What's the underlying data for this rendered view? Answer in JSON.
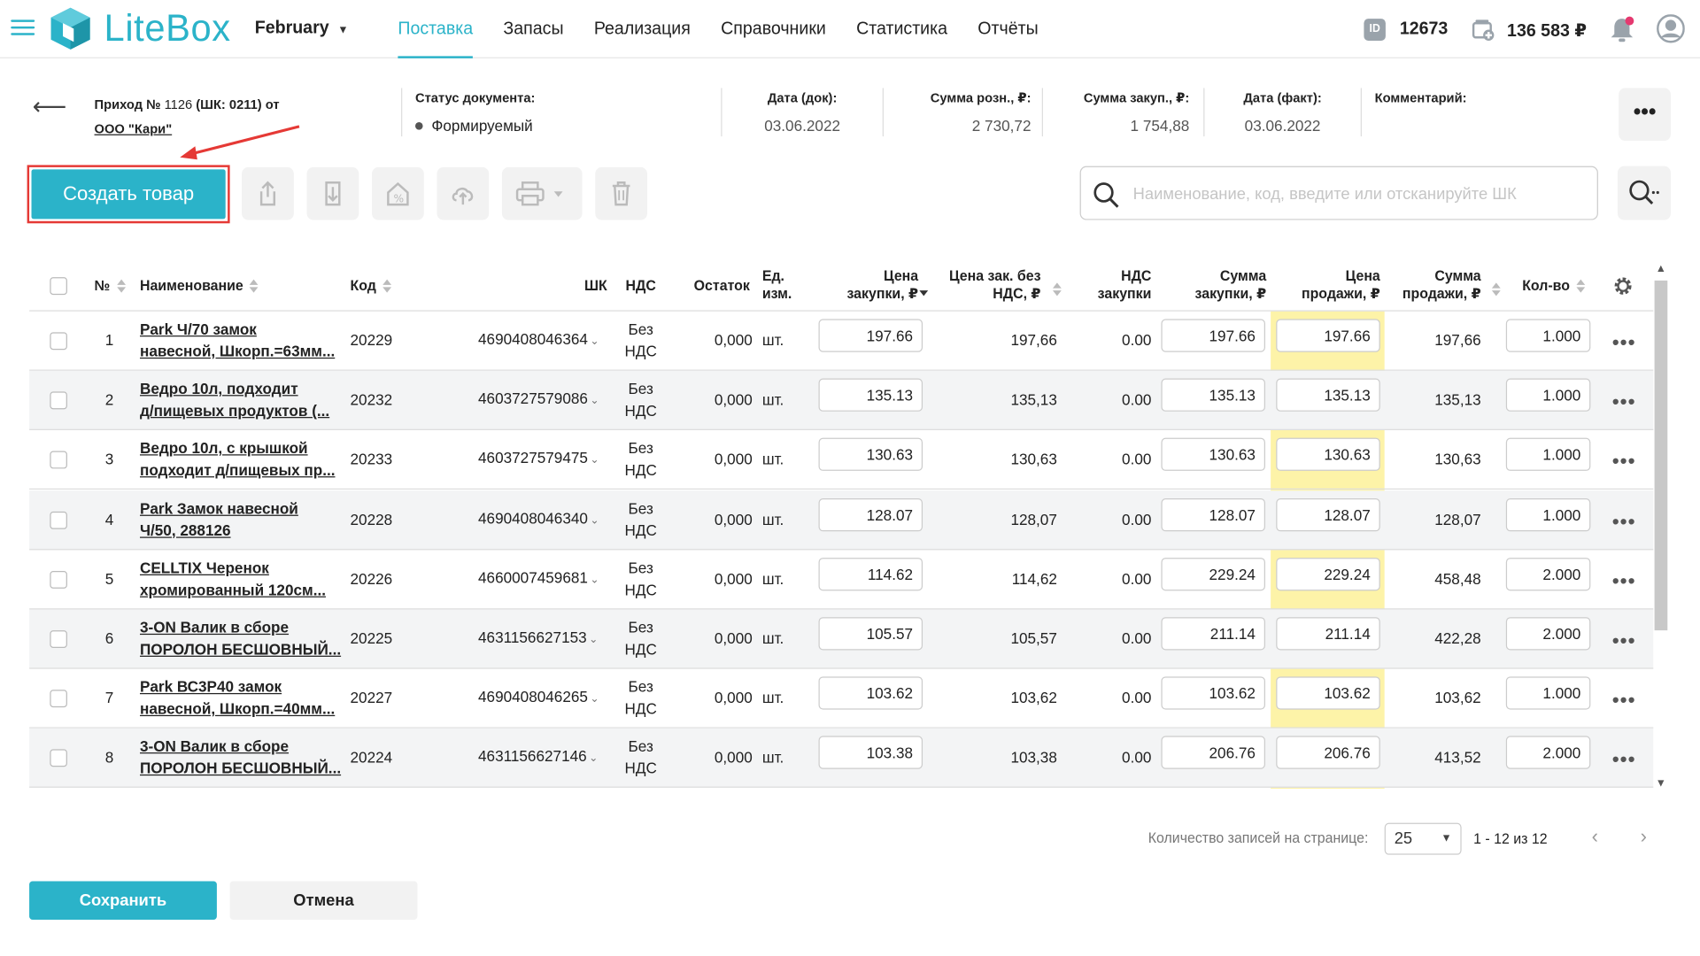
{
  "header": {
    "logo_text": "LiteBox",
    "month": "February",
    "nav": [
      {
        "label": "Поставка",
        "active": true
      },
      {
        "label": "Запасы"
      },
      {
        "label": "Реализация"
      },
      {
        "label": "Справочники"
      },
      {
        "label": "Статистика"
      },
      {
        "label": "Отчёты"
      }
    ],
    "id_badge": "ID",
    "user_id": "12673",
    "balance": "136 583 ₽",
    "accent_color": "#2bb3c9"
  },
  "document": {
    "title_prefix": "Приход №",
    "number": "1126",
    "barcode_part": "(ШК: 0211)",
    "from": "от",
    "supplier": "ООО \"Кари\"",
    "status_label": "Статус документа:",
    "status_value": "Формируемый",
    "date_doc_label": "Дата (док):",
    "date_doc": "03.06.2022",
    "sum_retail_label": "Сумма розн., ₽:",
    "sum_retail": "2 730,72",
    "sum_purchase_label": "Сумма закуп., ₽:",
    "sum_purchase": "1 754,88",
    "date_fact_label": "Дата (факт):",
    "date_fact": "03.06.2022",
    "comment_label": "Комментарий:"
  },
  "toolbar": {
    "create_label": "Создать товар",
    "search_placeholder": "Наименование, код, введите или отсканируйте ШК"
  },
  "table": {
    "columns": {
      "num": "№",
      "name": "Наименование",
      "code": "Код",
      "barcode": "ШК",
      "vat": "НДС",
      "stock": "Остаток",
      "unit_1": "Ед.",
      "unit_2": "изм.",
      "price_purchase_1": "Цена",
      "price_purchase_2": "закупки, ₽",
      "price_no_vat_1": "Цена зак. без",
      "price_no_vat_2": "НДС, ₽",
      "vat_purchase_1": "НДС",
      "vat_purchase_2": "закупки",
      "sum_purchase_1": "Сумма",
      "sum_purchase_2": "закупки, ₽",
      "price_sale_1": "Цена",
      "price_sale_2": "продажи, ₽",
      "sum_sale_1": "Сумма",
      "sum_sale_2": "продажи, ₽",
      "qty": "Кол-во"
    },
    "rows": [
      {
        "n": "1",
        "name1": "Park Ч/70 замок",
        "name2": "навесной, Шкорп.=63мм...",
        "code": "20229",
        "barcode": "4690408046364",
        "vat1": "Без",
        "vat2": "НДС",
        "stock": "0,000",
        "unit": "шт.",
        "price_purchase": "197.66",
        "price_no_vat": "197,66",
        "vat_purchase": "0.00",
        "sum_purchase": "197.66",
        "price_sale": "197.66",
        "sum_sale": "197,66",
        "qty": "1.000"
      },
      {
        "n": "2",
        "name1": "Ведро 10л, подходит",
        "name2": "д/пищевых продуктов (...",
        "code": "20232",
        "barcode": "4603727579086",
        "vat1": "Без",
        "vat2": "НДС",
        "stock": "0,000",
        "unit": "шт.",
        "price_purchase": "135.13",
        "price_no_vat": "135,13",
        "vat_purchase": "0.00",
        "sum_purchase": "135.13",
        "price_sale": "135.13",
        "sum_sale": "135,13",
        "qty": "1.000"
      },
      {
        "n": "3",
        "name1": "Ведро 10л, с крышкой",
        "name2": "подходит д/пищевых пр...",
        "code": "20233",
        "barcode": "4603727579475",
        "vat1": "Без",
        "vat2": "НДС",
        "stock": "0,000",
        "unit": "шт.",
        "price_purchase": "130.63",
        "price_no_vat": "130,63",
        "vat_purchase": "0.00",
        "sum_purchase": "130.63",
        "price_sale": "130.63",
        "sum_sale": "130,63",
        "qty": "1.000"
      },
      {
        "n": "4",
        "name1": "Park Замок навесной",
        "name2": "Ч/50, 288126",
        "code": "20228",
        "barcode": "4690408046340",
        "vat1": "Без",
        "vat2": "НДС",
        "stock": "0,000",
        "unit": "шт.",
        "price_purchase": "128.07",
        "price_no_vat": "128,07",
        "vat_purchase": "0.00",
        "sum_purchase": "128.07",
        "price_sale": "128.07",
        "sum_sale": "128,07",
        "qty": "1.000"
      },
      {
        "n": "5",
        "name1": "CELLTIX Черенок",
        "name2": "хромированный 120см...",
        "code": "20226",
        "barcode": "4660007459681",
        "vat1": "Без",
        "vat2": "НДС",
        "stock": "0,000",
        "unit": "шт.",
        "price_purchase": "114.62",
        "price_no_vat": "114,62",
        "vat_purchase": "0.00",
        "sum_purchase": "229.24",
        "price_sale": "229.24",
        "sum_sale": "458,48",
        "qty": "2.000"
      },
      {
        "n": "6",
        "name1": "3-ON Валик в сборе",
        "name2": "ПОРОЛОН БЕСШОВНЫЙ...",
        "code": "20225",
        "barcode": "4631156627153",
        "vat1": "Без",
        "vat2": "НДС",
        "stock": "0,000",
        "unit": "шт.",
        "price_purchase": "105.57",
        "price_no_vat": "105,57",
        "vat_purchase": "0.00",
        "sum_purchase": "211.14",
        "price_sale": "211.14",
        "sum_sale": "422,28",
        "qty": "2.000"
      },
      {
        "n": "7",
        "name1": "Park ВС3Р40 замок",
        "name2": "навесной, Шкорп.=40мм...",
        "code": "20227",
        "barcode": "4690408046265",
        "vat1": "Без",
        "vat2": "НДС",
        "stock": "0,000",
        "unit": "шт.",
        "price_purchase": "103.62",
        "price_no_vat": "103,62",
        "vat_purchase": "0.00",
        "sum_purchase": "103.62",
        "price_sale": "103.62",
        "sum_sale": "103,62",
        "qty": "1.000"
      },
      {
        "n": "8",
        "name1": "3-ON Валик в сборе",
        "name2": "ПОРОЛОН БЕСШОВНЫЙ...",
        "code": "20224",
        "barcode": "4631156627146",
        "vat1": "Без",
        "vat2": "НДС",
        "stock": "0,000",
        "unit": "шт.",
        "price_purchase": "103.38",
        "price_no_vat": "103,38",
        "vat_purchase": "0.00",
        "sum_purchase": "206.76",
        "price_sale": "206.76",
        "sum_sale": "413,52",
        "qty": "2.000"
      }
    ]
  },
  "pagination": {
    "per_page_label": "Количество записей на странице:",
    "per_page": "25",
    "range": "1 - 12 из 12"
  },
  "footer": {
    "save_label": "Сохранить",
    "cancel_label": "Отмена"
  },
  "icons": {
    "menu": "burger-menu-icon",
    "logo": "litebox-cube-icon",
    "wallet": "wallet-icon",
    "bell": "bell-icon",
    "user": "user-avatar-icon",
    "export": "upload-icon",
    "import": "download-icon",
    "discount": "house-percent-icon",
    "cloud": "cloud-upload-icon",
    "print": "printer-icon",
    "delete": "trash-icon",
    "search": "search-icon",
    "settings": "gear-icon"
  }
}
